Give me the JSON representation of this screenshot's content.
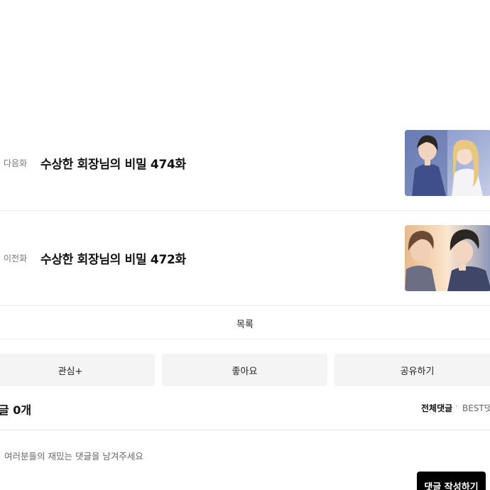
{
  "next_episode": {
    "tag": "다음화",
    "title": "수상한 회장님의 비밀 474화",
    "thumbnail": "manga-couple-thumbnail"
  },
  "prev_episode": {
    "tag": "이전화",
    "title": "수상한 회장님의 비밀 472화",
    "thumbnail": "manga-two-men-thumbnail"
  },
  "list_label": "목록",
  "actions": {
    "interest_label": "관심+",
    "like_label": "좋아요",
    "share_label": "공유하기"
  },
  "comments": {
    "count_label": "글 0개",
    "sort_all_label": "전체댓글",
    "sort_separator": "·",
    "sort_best_label": "BEST댓",
    "placeholder": "여러분들의 재밌는 댓글을 남겨주세요",
    "write_button_label": "댓글 작성하기"
  }
}
